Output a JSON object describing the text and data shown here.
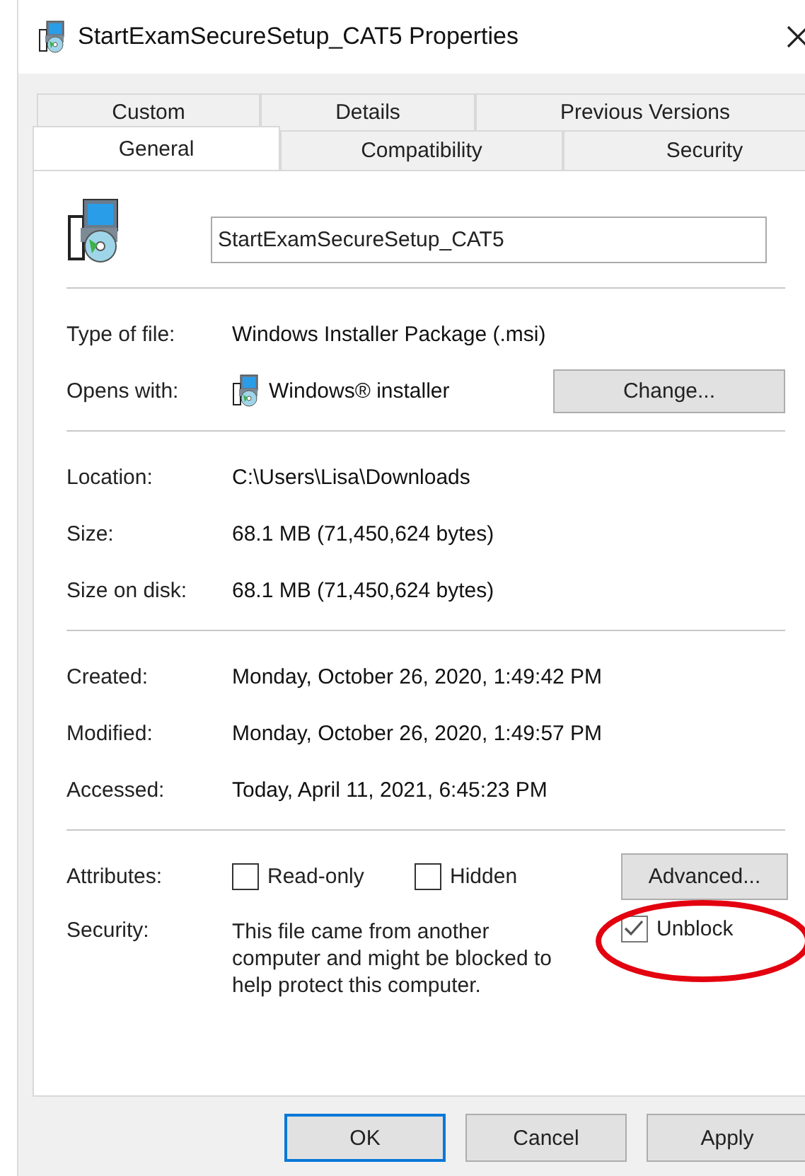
{
  "window": {
    "title": "StartExamSecureSetup_CAT5 Properties"
  },
  "tab_rows": [
    {
      "tabs": [
        {
          "label": "Custom",
          "selected": false
        },
        {
          "label": "Details",
          "selected": false
        },
        {
          "label": "Previous Versions",
          "selected": false
        }
      ]
    },
    {
      "tabs": [
        {
          "label": "General",
          "selected": true
        },
        {
          "label": "Compatibility",
          "selected": false
        },
        {
          "label": "Security",
          "selected": false
        }
      ]
    }
  ],
  "file_name": {
    "value": "StartExamSecureSetup_CAT5"
  },
  "groups": [
    {
      "rows": [
        {
          "kind": "text",
          "label": "Type of file:",
          "value": "Windows Installer Package (.msi)"
        },
        {
          "kind": "app",
          "label": "Opens with:",
          "value": "Windows® installer",
          "button": "Change..."
        }
      ]
    },
    {
      "rows": [
        {
          "kind": "text",
          "label": "Location:",
          "value": "C:\\Users\\Lisa\\Downloads"
        },
        {
          "kind": "text",
          "label": "Size:",
          "value": "68.1 MB (71,450,624 bytes)"
        },
        {
          "kind": "text",
          "label": "Size on disk:",
          "value": "68.1 MB (71,450,624 bytes)"
        }
      ]
    },
    {
      "rows": [
        {
          "kind": "text",
          "label": "Created:",
          "value": "Monday, October 26, 2020, 1:49:42 PM"
        },
        {
          "kind": "text",
          "label": "Modified:",
          "value": "Monday, October 26, 2020, 1:49:57 PM"
        },
        {
          "kind": "text",
          "label": "Accessed:",
          "value": "Today, April 11, 2021, 6:45:23 PM"
        }
      ]
    }
  ],
  "attributes": {
    "label": "Attributes:",
    "checkboxes": [
      {
        "label": "Read-only",
        "checked": false
      },
      {
        "label": "Hidden",
        "checked": false
      }
    ],
    "button": "Advanced..."
  },
  "security": {
    "label": "Security:",
    "text": "This file came from another computer and might be blocked to help protect this computer.",
    "checkbox": {
      "label": "Unblock",
      "checked": true
    }
  },
  "buttons": [
    {
      "label": "OK",
      "default": true
    },
    {
      "label": "Cancel",
      "default": false
    },
    {
      "label": "Apply",
      "default": false
    }
  ]
}
